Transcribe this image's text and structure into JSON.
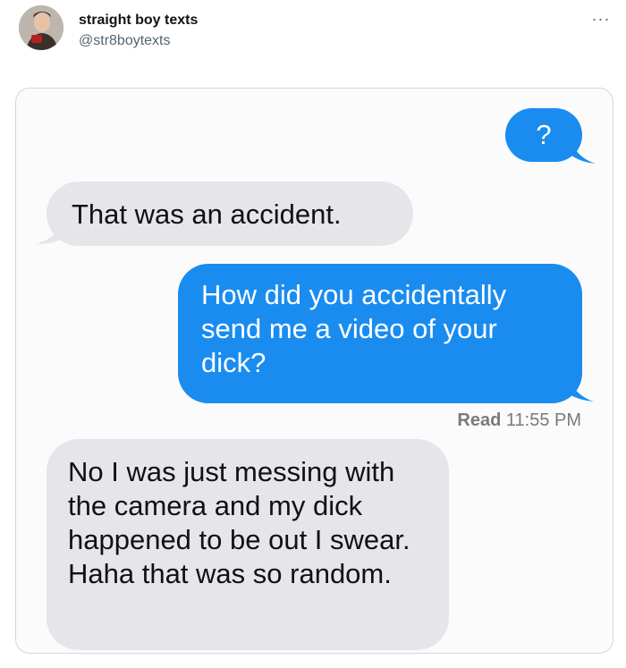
{
  "tweet": {
    "author_name": "straight boy texts",
    "author_handle": "@str8boytexts",
    "more_icon": "more-horizontal-icon"
  },
  "conversation": {
    "messages": [
      {
        "side": "sent",
        "text": "?"
      },
      {
        "side": "received",
        "text": "That was an accident."
      },
      {
        "side": "sent",
        "text": "How did you accidentally send me a video of your dick?"
      },
      {
        "side": "received",
        "text": "No I was just messing with the camera and my dick happened to be out I swear. Haha that was so random."
      }
    ],
    "read_label": "Read",
    "read_time": "11:55 PM"
  },
  "colors": {
    "sent_bubble": "#1a8cf0",
    "received_bubble": "#e5e5ea"
  }
}
